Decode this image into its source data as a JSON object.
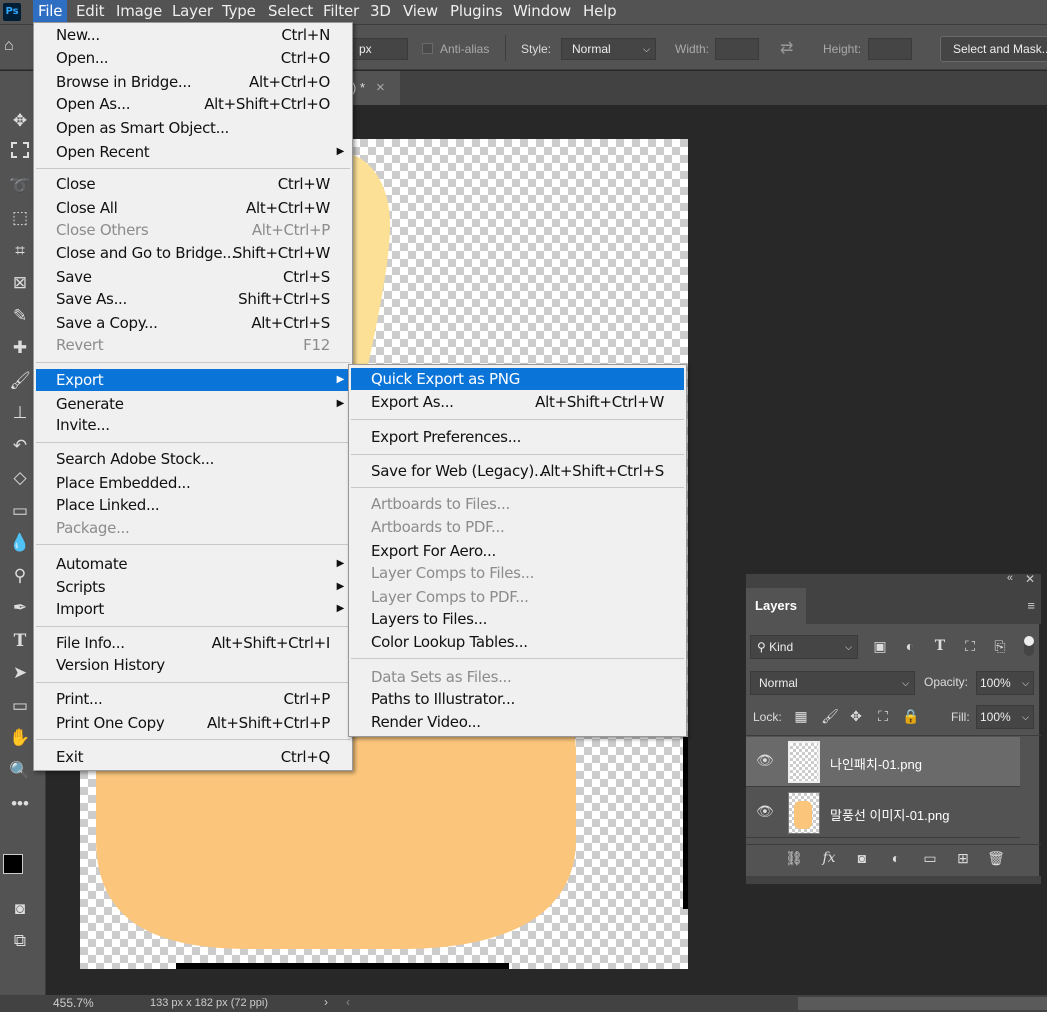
{
  "app": {
    "logo": "Ps"
  },
  "menubar": [
    "File",
    "Edit",
    "Image",
    "Layer",
    "Type",
    "Select",
    "Filter",
    "3D",
    "View",
    "Plugins",
    "Window",
    "Help"
  ],
  "options": {
    "feather_unit": "px",
    "antialias": "Anti-alias",
    "style_label": "Style:",
    "style_value": "Normal",
    "width_label": "Width:",
    "height_label": "Height:",
    "select_mask": "Select and Mask..."
  },
  "document": {
    "tab_title": ") *",
    "close": "×"
  },
  "file_menu": [
    {
      "label": "New...",
      "shortcut": "Ctrl+N"
    },
    {
      "label": "Open...",
      "shortcut": "Ctrl+O"
    },
    {
      "label": "Browse in Bridge...",
      "shortcut": "Alt+Ctrl+O"
    },
    {
      "label": "Open As...",
      "shortcut": "Alt+Shift+Ctrl+O"
    },
    {
      "label": "Open as Smart Object...",
      "shortcut": ""
    },
    {
      "label": "Open Recent",
      "shortcut": "",
      "submenu": true
    },
    {
      "label": "Close",
      "shortcut": "Ctrl+W"
    },
    {
      "label": "Close All",
      "shortcut": "Alt+Ctrl+W"
    },
    {
      "label": "Close Others",
      "shortcut": "Alt+Ctrl+P",
      "disabled": true
    },
    {
      "label": "Close and Go to Bridge...",
      "shortcut": "Shift+Ctrl+W"
    },
    {
      "label": "Save",
      "shortcut": "Ctrl+S"
    },
    {
      "label": "Save As...",
      "shortcut": "Shift+Ctrl+S"
    },
    {
      "label": "Save a Copy...",
      "shortcut": "Alt+Ctrl+S"
    },
    {
      "label": "Revert",
      "shortcut": "F12",
      "disabled": true
    },
    {
      "label": "Export",
      "shortcut": "",
      "submenu": true,
      "highlighted": true
    },
    {
      "label": "Generate",
      "shortcut": "",
      "submenu": true
    },
    {
      "label": "Invite...",
      "shortcut": ""
    },
    {
      "label": "Search Adobe Stock...",
      "shortcut": ""
    },
    {
      "label": "Place Embedded...",
      "shortcut": ""
    },
    {
      "label": "Place Linked...",
      "shortcut": ""
    },
    {
      "label": "Package...",
      "shortcut": "",
      "disabled": true
    },
    {
      "label": "Automate",
      "shortcut": "",
      "submenu": true
    },
    {
      "label": "Scripts",
      "shortcut": "",
      "submenu": true
    },
    {
      "label": "Import",
      "shortcut": "",
      "submenu": true
    },
    {
      "label": "File Info...",
      "shortcut": "Alt+Shift+Ctrl+I"
    },
    {
      "label": "Version History",
      "shortcut": ""
    },
    {
      "label": "Print...",
      "shortcut": "Ctrl+P"
    },
    {
      "label": "Print One Copy",
      "shortcut": "Alt+Shift+Ctrl+P"
    },
    {
      "label": "Exit",
      "shortcut": "Ctrl+Q"
    }
  ],
  "export_menu": [
    {
      "label": "Quick Export as PNG",
      "shortcut": "",
      "highlighted": true
    },
    {
      "label": "Export As...",
      "shortcut": "Alt+Shift+Ctrl+W"
    },
    {
      "label": "Export Preferences...",
      "shortcut": ""
    },
    {
      "label": "Save for Web (Legacy)...",
      "shortcut": "Alt+Shift+Ctrl+S"
    },
    {
      "label": "Artboards to Files...",
      "shortcut": "",
      "disabled": true
    },
    {
      "label": "Artboards to PDF...",
      "shortcut": "",
      "disabled": true
    },
    {
      "label": "Export For Aero...",
      "shortcut": ""
    },
    {
      "label": "Layer Comps to Files...",
      "shortcut": "",
      "disabled": true
    },
    {
      "label": "Layer Comps to PDF...",
      "shortcut": "",
      "disabled": true
    },
    {
      "label": "Layers to Files...",
      "shortcut": ""
    },
    {
      "label": "Color Lookup Tables...",
      "shortcut": ""
    },
    {
      "label": "Data Sets as Files...",
      "shortcut": "",
      "disabled": true
    },
    {
      "label": "Paths to Illustrator...",
      "shortcut": ""
    },
    {
      "label": "Render Video...",
      "shortcut": ""
    }
  ],
  "layers_panel": {
    "title": "Layers",
    "filter_kind": "Kind",
    "blend_mode": "Normal",
    "opacity_label": "Opacity:",
    "opacity_value": "100%",
    "lock_label": "Lock:",
    "fill_label": "Fill:",
    "fill_value": "100%",
    "layers": [
      {
        "name": "나인패치-01.png",
        "selected": true
      },
      {
        "name": "말풍선 이미지-01.png",
        "selected": false
      }
    ]
  },
  "status": {
    "zoom": "455.7%",
    "doc_info": "133 px x 182 px (72 ppi)",
    "arrow": "›",
    "left_arrow": "‹"
  },
  "colors": {
    "menu_highlight": "#0a74d8",
    "menubar_active": "#2f6fc3",
    "cat_body": "#fce096",
    "cat_cheek": "#fbc1a0",
    "bottom_shape": "#fbc67c"
  },
  "icons": {
    "toolbar": [
      "move-icon",
      "marquee-icon",
      "lasso-icon",
      "object-select-icon",
      "crop-icon",
      "frame-icon",
      "eyedropper-icon",
      "healing-icon",
      "brush-icon",
      "stamp-icon",
      "history-brush-icon",
      "eraser-icon",
      "gradient-icon",
      "blur-icon",
      "dodge-icon",
      "pen-icon",
      "type-icon",
      "path-select-icon",
      "rectangle-icon",
      "hand-icon",
      "zoom-icon",
      "more-icon"
    ]
  }
}
